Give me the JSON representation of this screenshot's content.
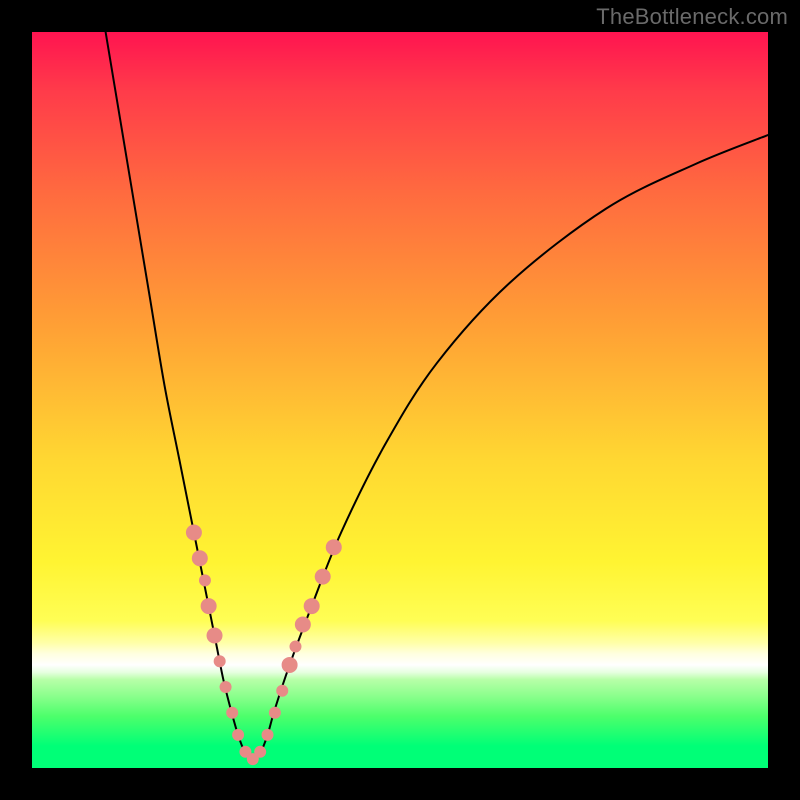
{
  "watermark": "TheBottleneck.com",
  "chart_data": {
    "type": "line",
    "title": "",
    "xlabel": "",
    "ylabel": "",
    "xlim": [
      0,
      100
    ],
    "ylim": [
      0,
      100
    ],
    "curve": {
      "x": [
        10,
        12,
        14,
        16,
        18,
        20,
        22,
        24,
        25,
        26,
        27,
        28,
        29,
        30,
        31,
        32,
        33,
        35,
        38,
        42,
        48,
        55,
        65,
        78,
        90,
        100
      ],
      "y": [
        100,
        88,
        76,
        64,
        52,
        42,
        32,
        22,
        17,
        12,
        8,
        4.5,
        2,
        1,
        2,
        4.5,
        8,
        14,
        22,
        32,
        44,
        55,
        66,
        76,
        82,
        86
      ],
      "color": "#000000",
      "stroke_width": 2
    },
    "markers": {
      "color": "#e78b87",
      "radius_small": 6,
      "radius_large": 8,
      "points": [
        {
          "x": 22.0,
          "y": 32.0,
          "r": 8
        },
        {
          "x": 22.8,
          "y": 28.5,
          "r": 8
        },
        {
          "x": 23.5,
          "y": 25.5,
          "r": 6
        },
        {
          "x": 24.0,
          "y": 22.0,
          "r": 8
        },
        {
          "x": 24.8,
          "y": 18.0,
          "r": 8
        },
        {
          "x": 25.5,
          "y": 14.5,
          "r": 6
        },
        {
          "x": 26.3,
          "y": 11.0,
          "r": 6
        },
        {
          "x": 27.2,
          "y": 7.5,
          "r": 6
        },
        {
          "x": 28.0,
          "y": 4.5,
          "r": 6
        },
        {
          "x": 29.0,
          "y": 2.2,
          "r": 6
        },
        {
          "x": 30.0,
          "y": 1.2,
          "r": 6
        },
        {
          "x": 31.0,
          "y": 2.2,
          "r": 6
        },
        {
          "x": 32.0,
          "y": 4.5,
          "r": 6
        },
        {
          "x": 33.0,
          "y": 7.5,
          "r": 6
        },
        {
          "x": 34.0,
          "y": 10.5,
          "r": 6
        },
        {
          "x": 35.0,
          "y": 14.0,
          "r": 8
        },
        {
          "x": 35.8,
          "y": 16.5,
          "r": 6
        },
        {
          "x": 36.8,
          "y": 19.5,
          "r": 8
        },
        {
          "x": 38.0,
          "y": 22.0,
          "r": 8
        },
        {
          "x": 39.5,
          "y": 26.0,
          "r": 8
        },
        {
          "x": 41.0,
          "y": 30.0,
          "r": 8
        }
      ]
    },
    "gradient_stops": [
      {
        "pos": 0.0,
        "color": "#ff1450"
      },
      {
        "pos": 0.08,
        "color": "#ff3b4a"
      },
      {
        "pos": 0.22,
        "color": "#ff6b3f"
      },
      {
        "pos": 0.4,
        "color": "#ffa035"
      },
      {
        "pos": 0.58,
        "color": "#ffd732"
      },
      {
        "pos": 0.72,
        "color": "#fff432"
      },
      {
        "pos": 0.8,
        "color": "#fffe55"
      },
      {
        "pos": 0.83,
        "color": "#ffffa8"
      },
      {
        "pos": 0.845,
        "color": "#ffffe0"
      },
      {
        "pos": 0.86,
        "color": "#ffffff"
      },
      {
        "pos": 0.87,
        "color": "#e6ffe0"
      },
      {
        "pos": 0.88,
        "color": "#b7ffa8"
      },
      {
        "pos": 0.9,
        "color": "#8fff8f"
      },
      {
        "pos": 0.93,
        "color": "#4cff6b"
      },
      {
        "pos": 0.97,
        "color": "#00ff77"
      },
      {
        "pos": 1.0,
        "color": "#00ff77"
      }
    ]
  }
}
